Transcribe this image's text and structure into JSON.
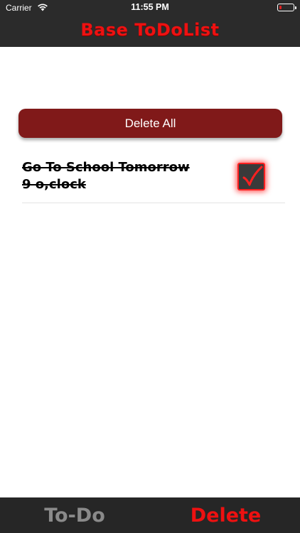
{
  "status_bar": {
    "carrier": "Carrier",
    "time": "11:55 PM"
  },
  "nav": {
    "title": "Base ToDoList"
  },
  "main": {
    "delete_all_label": "Delete All",
    "todos": [
      {
        "text": "Go To School Tomorrow 9 o,clock",
        "checked": true
      }
    ]
  },
  "tabs": [
    {
      "label": "To-Do",
      "active": false
    },
    {
      "label": "Delete",
      "active": true
    }
  ],
  "colors": {
    "bar_background": "#2b2b2b",
    "accent_red": "#ee1111",
    "button_red": "#801919",
    "inactive_tab": "#8a8a8a"
  },
  "icons": [
    "wifi-icon",
    "battery-icon",
    "checkmark-icon"
  ]
}
